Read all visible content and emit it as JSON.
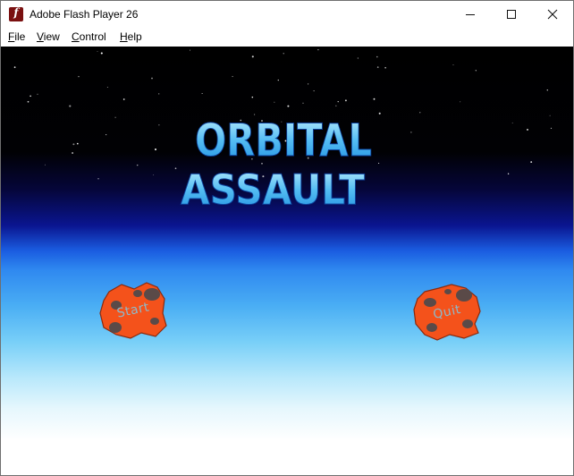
{
  "window": {
    "title": "Adobe Flash Player 26",
    "app_icon_glyph": "f",
    "controls": [
      "minimize-icon",
      "maximize-icon",
      "close-icon"
    ]
  },
  "menu": {
    "items": [
      {
        "label": "File",
        "mnemonic": "F",
        "rest": "ile"
      },
      {
        "label": "View",
        "mnemonic": "V",
        "rest": "iew"
      },
      {
        "label": "Control",
        "mnemonic": "C",
        "rest": "ontrol"
      },
      {
        "label": "Help",
        "mnemonic": "H",
        "rest": "elp"
      }
    ]
  },
  "game": {
    "title_line1": "ORBITAL",
    "title_line2": "ASSAULT",
    "start_label": "Start",
    "quit_label": "Quit"
  },
  "colors": {
    "rock_fill": "#f4521b",
    "rock_crater": "#5a4a48",
    "title_light": "#a8e6fa",
    "title_mid": "#3fb2f0",
    "title_dark": "#1e8fe2"
  }
}
